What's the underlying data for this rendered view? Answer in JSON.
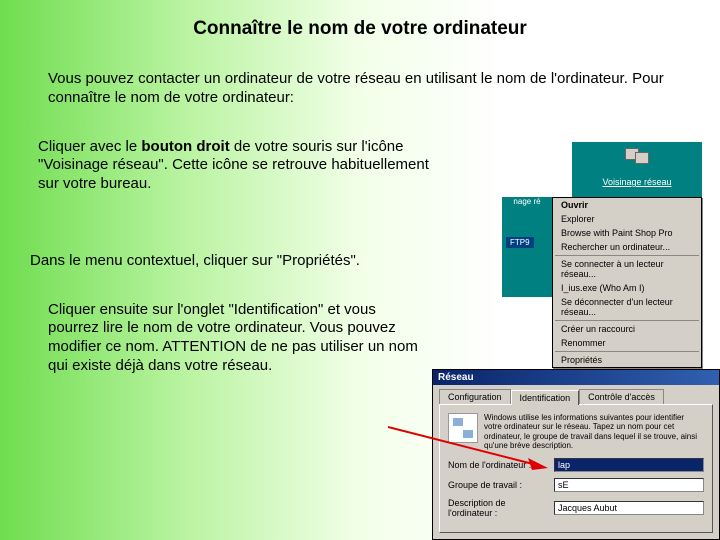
{
  "title": "Connaître le nom de votre ordinateur",
  "intro": "Vous pouvez contacter un ordinateur de votre réseau en utilisant le nom de l'ordinateur. Pour connaître le nom de votre ordinateur:",
  "step1_pre": "Cliquer avec le ",
  "step1_bold": "bouton droit",
  "step1_post": " de votre souris sur l'icône \"Voisinage réseau\". Cette icône se retrouve habituellement sur votre bureau.",
  "step2": "Dans le menu contextuel, cliquer sur \"Propriétés\".",
  "step3": "Cliquer ensuite sur l'onglet \"Identification\" et vous pourrez lire le nom de votre ordinateur. Vous pouvez modifier ce nom. ATTENTION de ne pas utiliser un nom qui existe déjà dans votre réseau.",
  "desktop": {
    "voisinage_label": "Voisinage réseau",
    "nage_label": "nage ré",
    "ftp_label": "FTP9"
  },
  "context_menu": {
    "items": [
      {
        "label": "Ouvrir",
        "bold": true
      },
      {
        "label": "Explorer"
      },
      {
        "label": "Browse with Paint Shop Pro"
      },
      {
        "label": "Rechercher un ordinateur..."
      },
      {
        "sep": true
      },
      {
        "label": "Se connecter à un lecteur réseau..."
      },
      {
        "label": "I_ius.exe (Who Am I)"
      },
      {
        "label": "Se déconnecter d'un lecteur réseau..."
      },
      {
        "sep": true
      },
      {
        "label": "Créer un raccourci"
      },
      {
        "label": "Renommer"
      },
      {
        "sep": true
      },
      {
        "label": "Propriétés"
      }
    ]
  },
  "dialog": {
    "title": "Réseau",
    "tabs": [
      "Configuration",
      "Identification",
      "Contrôle d'accès"
    ],
    "active_tab": 1,
    "info_text": "Windows utilise les informations suivantes pour identifier votre ordinateur sur le réseau. Tapez un nom pour cet ordinateur, le groupe de travail dans lequel il se trouve, ainsi qu'une brève description.",
    "fields": {
      "name_label": "Nom de l'ordinateur :",
      "name_value": "lap",
      "group_label": "Groupe de travail :",
      "group_value": "sE",
      "desc_label": "Description de l'ordinateur :",
      "desc_value": "Jacques Aubut"
    }
  }
}
